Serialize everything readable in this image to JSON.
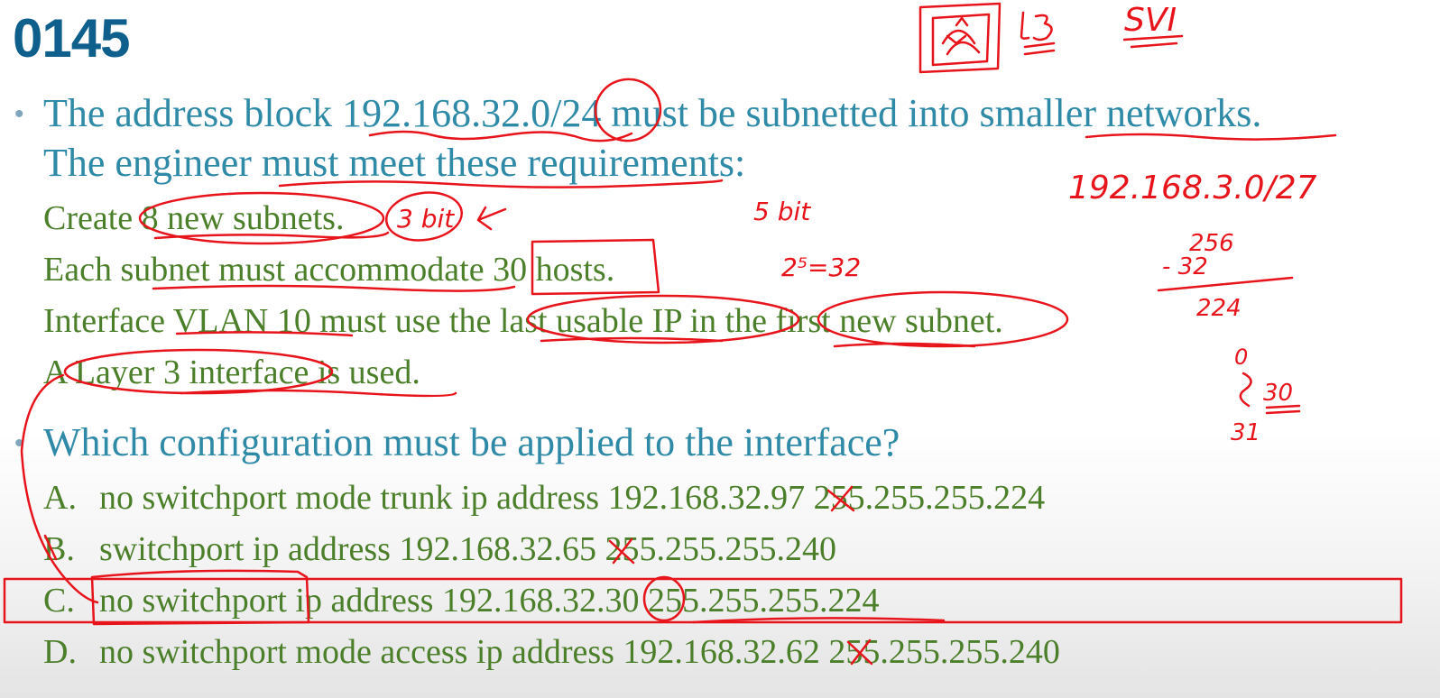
{
  "slide": {
    "number": "0145",
    "question_line1": "The address block 192.168.32.0/24 must be subnetted into smaller networks.",
    "question_line2": "The engineer must meet these requirements:",
    "requirements": [
      "Create 8 new subnets.",
      "Each subnet must accommodate 30 hosts.",
      "Interface VLAN 10 must use the last usable IP in the first new subnet.",
      "A Layer 3 interface is used."
    ],
    "prompt": "Which configuration must be applied to the interface?",
    "options": [
      {
        "letter": "A.",
        "text": "no switchport mode trunk ip address 192.168.32.97 255.255.255.224"
      },
      {
        "letter": "B.",
        "text": "switchport ip address 192.168.32.65 255.255.255.240"
      },
      {
        "letter": "C.",
        "text": "no switchport ip address 192.168.32.30 255.255.255.224"
      },
      {
        "letter": "D.",
        "text": "no switchport mode access ip address 192.168.32.62 255.255.255.240"
      }
    ]
  },
  "annotations": {
    "ink_color": "#e8141c",
    "notes": [
      "L3",
      "SVI",
      "3 bit",
      "5 bit",
      "2⁵=32",
      "192.168.3.0/27",
      "256",
      "- 32",
      "224",
      "0",
      "30",
      "31"
    ],
    "selected_option": "C."
  }
}
